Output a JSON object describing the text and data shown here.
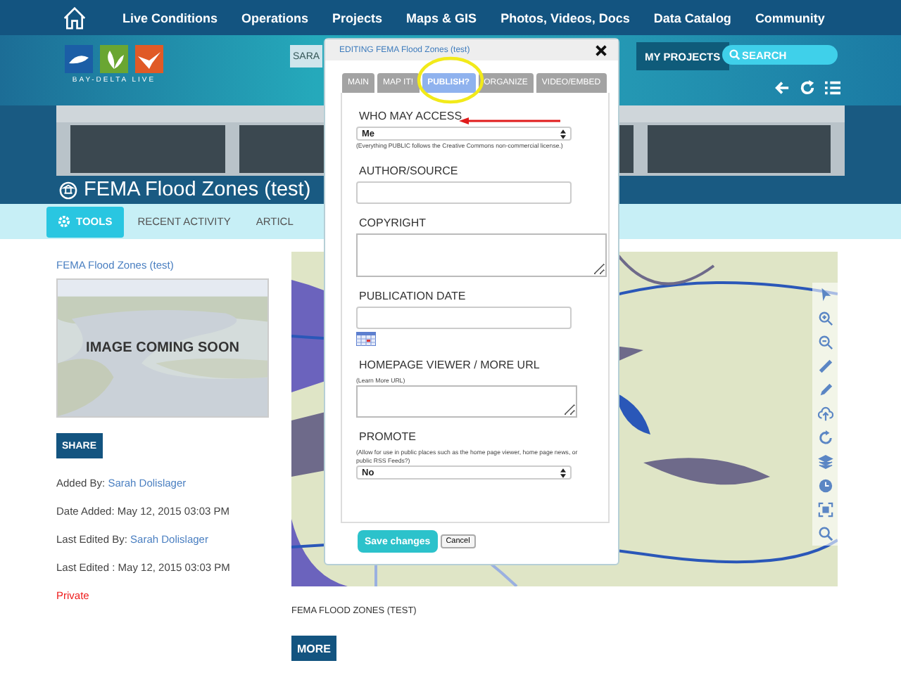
{
  "top_nav": {
    "items": [
      "Live Conditions",
      "Operations",
      "Projects",
      "Maps & GIS",
      "Photos, Videos, Docs",
      "Data Catalog",
      "Community"
    ]
  },
  "header": {
    "logo_text": "BAY-DELTA LIVE",
    "user_button": "SARA",
    "projects_button": "MY PROJECTS",
    "search": {
      "placeholder": "SEARCH"
    }
  },
  "page_title": "FEMA Flood Zones (test)",
  "tabs": [
    {
      "label": "TOOLS",
      "selected": true
    },
    {
      "label": "RECENT ACTIVITY",
      "selected": false
    },
    {
      "label": "ARTICL",
      "selected": false
    }
  ],
  "item": {
    "title_link": "FEMA Flood Zones (test)",
    "image_caption": "IMAGE COMING SOON",
    "share_button": "SHARE",
    "meta": [
      {
        "label": "Added By:",
        "value": "Sarah Dolislager",
        "kind": "link"
      },
      {
        "label": "Date Added:",
        "value": "May 12, 2015 03:03 PM",
        "kind": "text"
      },
      {
        "label": "Last Edited By:",
        "value": "Sarah Dolislager",
        "kind": "link"
      },
      {
        "label": "Last Edited :",
        "value": "May 12, 2015 03:03 PM",
        "kind": "text"
      }
    ],
    "visibility": "Private"
  },
  "map": {
    "caption": "FEMA FLOOD ZONES (TEST)",
    "more_button": "MORE"
  },
  "dialog": {
    "title": "EDITING FEMA Flood Zones (test)",
    "tabs": [
      {
        "label": "MAIN",
        "selected": false
      },
      {
        "label": "MAP IT!",
        "selected": false
      },
      {
        "label": "PUBLISH?",
        "selected": true
      },
      {
        "label": "ORGANIZE",
        "selected": false
      },
      {
        "label": "VIDEO/EMBED",
        "selected": false
      }
    ],
    "fields": [
      {
        "kind": "select",
        "label": "WHO MAY ACCESS",
        "value": "Me",
        "note": "(Everything PUBLIC follows the Creative Commons non-commercial license.)"
      },
      {
        "kind": "input",
        "label": "AUTHOR/SOURCE"
      },
      {
        "kind": "textarea",
        "label": "COPYRIGHT"
      },
      {
        "kind": "date",
        "label": "PUBLICATION DATE"
      },
      {
        "kind": "textarea",
        "label": "HOMEPAGE VIEWER / MORE URL",
        "hint": "(Learn More URL)"
      },
      {
        "kind": "select",
        "label": "PROMOTE",
        "hint": "(Allow for use in public places such as the home page viewer, home page news, or public RSS Feeds?)",
        "value": "No"
      }
    ],
    "save_button": "Save changes",
    "cancel_button": "Cancel"
  }
}
